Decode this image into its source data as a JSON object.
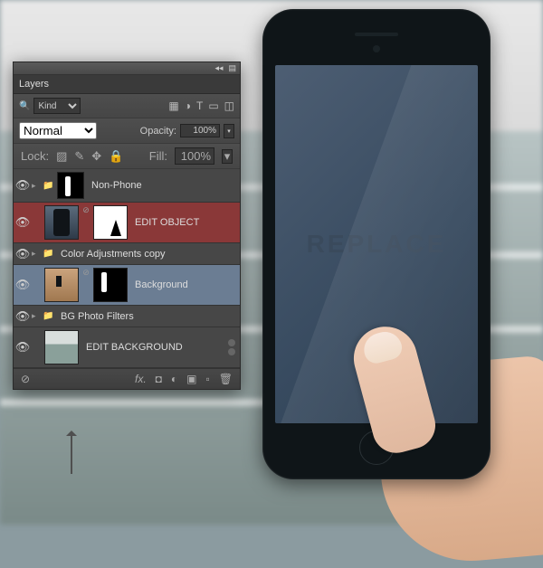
{
  "panel": {
    "title": "Layers",
    "filter_label": "Kind",
    "blend_mode": "Normal",
    "opacity_label": "Opacity:",
    "opacity_value": "100%",
    "lock_label": "Lock:",
    "fill_label": "Fill:",
    "fill_value": "100%"
  },
  "layers": [
    {
      "name": "Non-Phone",
      "visible": true,
      "folder": true,
      "thumbs": [
        "mask-b"
      ],
      "expanded": false
    },
    {
      "name": "EDIT OBJECT",
      "visible": true,
      "selected": true,
      "thumbs": [
        "ph-th",
        "mask-w"
      ],
      "expanded": false
    },
    {
      "name": "Color Adjustments copy",
      "visible": true,
      "folder": true,
      "small": true,
      "expanded": false
    },
    {
      "name": "Background",
      "visible": true,
      "highlight": true,
      "thumbs": [
        "bg-th",
        "mask-b"
      ],
      "expanded": false
    },
    {
      "name": "BG Photo Filters",
      "visible": true,
      "folder": true,
      "small": true,
      "expanded": false
    },
    {
      "name": "EDIT BACKGROUND",
      "visible": true,
      "thumbs": [
        "bld-th"
      ],
      "advanced": true,
      "expanded": false
    }
  ],
  "screen_text": "Replace",
  "icons": {
    "image": "▦",
    "fx": "◑",
    "type": "T",
    "shape": "▭",
    "smart": "◫",
    "trans": "▨",
    "brush": "✎",
    "move": "✥",
    "lock": "🔒",
    "foot_link": "⊘",
    "foot_fx": "fx.",
    "foot_mask": "◘",
    "foot_adj": "◐",
    "foot_grp": "▣",
    "foot_new": "▫",
    "foot_del": "🗑",
    "search": "🔍",
    "collapse": "◂◂",
    "menu": "▤"
  }
}
